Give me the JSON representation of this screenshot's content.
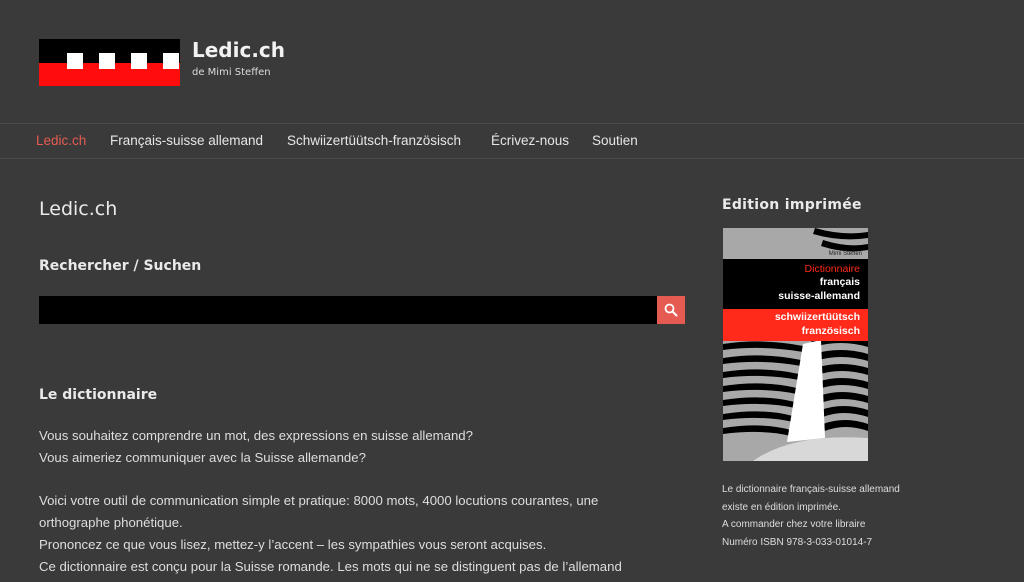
{
  "site": {
    "title": "Ledic.ch",
    "description": "de Mimi Steffen",
    "logo_colors": {
      "black": "#000000",
      "red": "#ff0d0d",
      "white": "#ffffff"
    }
  },
  "nav": {
    "items": [
      {
        "label": "Ledic.ch",
        "active": true
      },
      {
        "label": "Français-suisse allemand",
        "active": false
      },
      {
        "label": "Schwiizertüütsch-französisch",
        "active": false
      },
      {
        "label": "Écrivez-nous",
        "active": false
      },
      {
        "label": "Soutien",
        "active": false
      }
    ]
  },
  "main": {
    "page_title": "Ledic.ch",
    "search": {
      "label": "Rechercher / Suchen",
      "value": "",
      "button_icon": "search-icon"
    },
    "section_heading": "Le dictionnaire",
    "paragraphs": [
      "Vous souhaitez comprendre un mot, des expressions en suisse allemand?",
      "Vous aimeriez communiquer avec la Suisse allemande?",
      "Voici votre outil de communication simple et pratique: 8000 mots, 4000 locutions courantes, une",
      "orthographe phonétique.",
      "Prononcez ce que vous lisez, mettez-y l’accent – les sympathies vous seront acquises.",
      "Ce dictionnaire est conçu pour la Suisse romande. Les mots qui ne se distinguent pas de l’allemand"
    ]
  },
  "sidebar": {
    "heading": "Edition imprimée",
    "book": {
      "author": "Mimi Steffen",
      "title_line1": "Dictionnaire",
      "title_line2": "français",
      "title_line3": "suisse-allemand",
      "title_line4": "schwiizertüütsch",
      "title_line5": "französisch"
    },
    "text_lines": [
      "Le dictionnaire français-suisse allemand",
      "existe en édition imprimée.",
      "A commander chez votre libraire",
      "Numéro ISBN 978-3-033-01014-7"
    ]
  },
  "colors": {
    "background": "#3a3a3a",
    "accent": "#e55b52",
    "search_input_bg": "#000000"
  }
}
